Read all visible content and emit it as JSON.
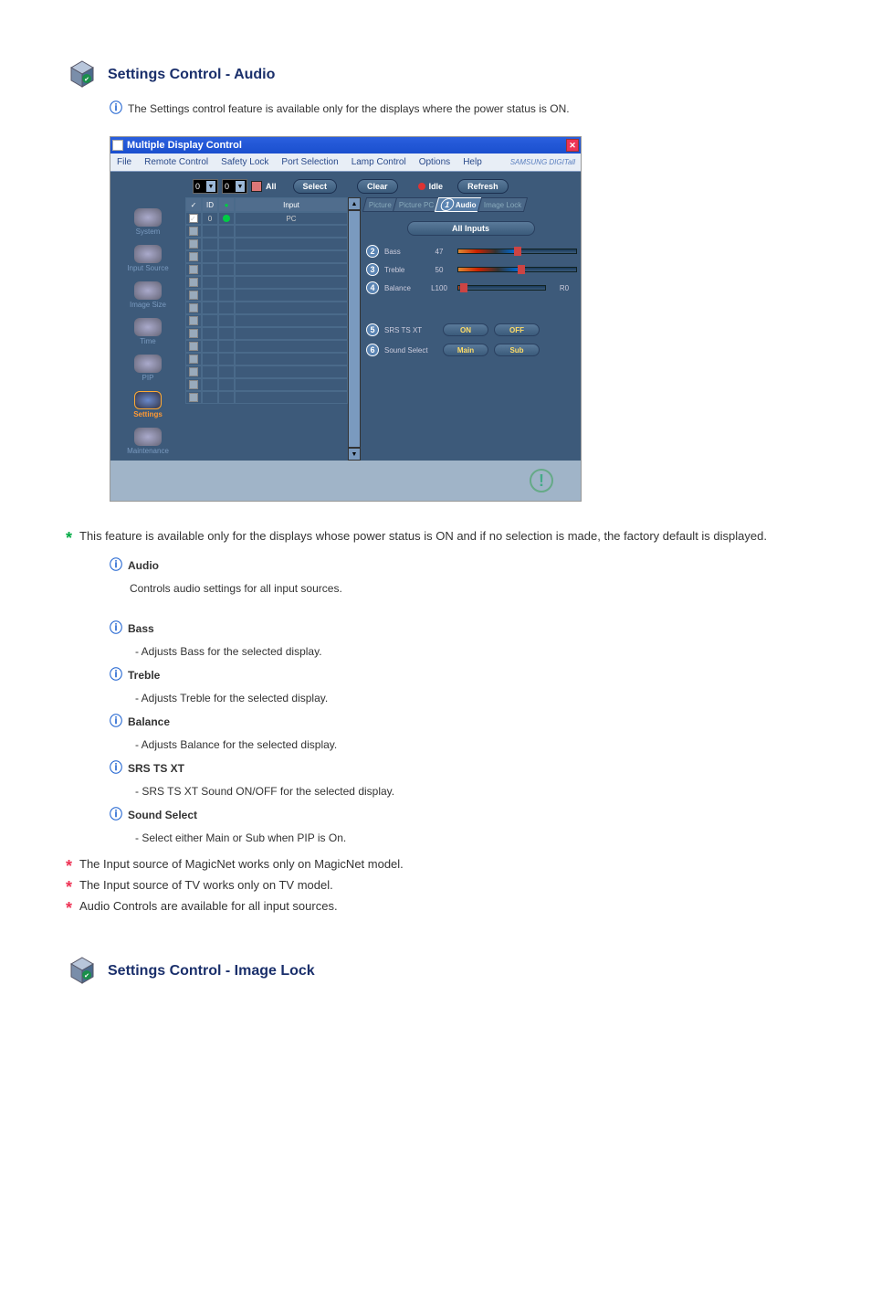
{
  "section1": {
    "title": "Settings Control - Audio",
    "lead": "The Settings control feature is available only for the displays where the power status is ON.",
    "items": {
      "i1": {
        "label": "Audio",
        "desc": "Controls audio settings for all input sources."
      },
      "i2": {
        "label": "Bass",
        "desc": "- Adjusts Bass for the selected display."
      },
      "i3": {
        "label": "Treble",
        "desc": "- Adjusts Treble for the selected display."
      },
      "i4": {
        "label": "Balance",
        "desc": "- Adjusts Balance for the selected display."
      },
      "i5": {
        "label": "SRS TS XT",
        "desc": "- SRS TS XT Sound ON/OFF for the selected display."
      },
      "i6": {
        "label": "Sound Select",
        "desc": "- Select either Main or Sub when PIP is On."
      }
    },
    "notes": {
      "a": "This feature is available only for the displays whose power status is ON and if no selection is made, the factory default is displayed.",
      "b": "The Input source of MagicNet works only on MagicNet model.",
      "c": "The Input source of TV works only on TV model.",
      "d": "Audio Controls are available for all input sources."
    }
  },
  "section2": {
    "title": "Settings Control - Image Lock"
  },
  "app": {
    "title": "Multiple Display Control",
    "menu": {
      "file": "File",
      "remote": "Remote Control",
      "safety": "Safety Lock",
      "port": "Port Selection",
      "lamp": "Lamp Control",
      "options": "Options",
      "help": "Help"
    },
    "brand": "SAMSUNG DIGITall",
    "top": {
      "dd1": "0",
      "dd2": "0",
      "all": "All",
      "select": "Select",
      "clear": "Clear",
      "idle": "Idle",
      "refresh": "Refresh"
    },
    "nav": {
      "system": "System",
      "input": "Input Source",
      "image": "Image Size",
      "time": "Time",
      "pip": "PIP",
      "settings": "Settings",
      "maint": "Maintenance"
    },
    "table": {
      "h1": "✓",
      "h2": "ID",
      "h3": "●",
      "h4": "Input",
      "r1_id": "0",
      "r1_input": "PC"
    },
    "tabs": {
      "picture": "Picture",
      "picturepc": "Picture PC",
      "audio": "Audio",
      "imagelock": "Image Lock"
    },
    "panel": {
      "allinputs": "All Inputs",
      "bass": "Bass",
      "bass_val": "47",
      "treble": "Treble",
      "treble_val": "50",
      "balance": "Balance",
      "balance_l": "L100",
      "balance_r": "R0",
      "srs": "SRS TS XT",
      "on": "ON",
      "off": "OFF",
      "sound": "Sound Select",
      "main": "Main",
      "sub": "Sub"
    }
  }
}
